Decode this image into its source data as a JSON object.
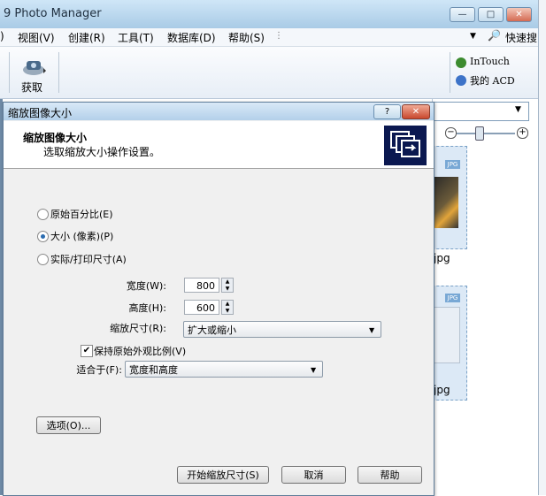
{
  "app": {
    "title": "9 Photo Manager",
    "window_buttons": {
      "minimize": "—",
      "maximize": "□",
      "close": "✕"
    }
  },
  "menu": {
    "items": [
      ") ",
      "视图(V)",
      "创建(R)",
      "工具(T)",
      "数据库(D)",
      "帮助(S)"
    ],
    "quick_search_label": "快速搜"
  },
  "toolbar": {
    "acquire_label": "获取",
    "intouch_label": "InTouch",
    "myacd_label": "我的 ACD"
  },
  "thumbnails": [
    {
      "badge": "JPG",
      "name": "jpg"
    },
    {
      "badge": "JPG",
      "name": "jpg"
    }
  ],
  "dialog": {
    "title": "缩放图像大小",
    "help_btn": "?",
    "close_btn": "✕",
    "header_title": "缩放图像大小",
    "header_subtitle": "选取缩放大小操作设置。",
    "options": [
      {
        "label": "原始百分比(E)",
        "checked": false
      },
      {
        "label": "大小 (像素)(P)",
        "checked": true
      },
      {
        "label": "实际/打印尺寸(A)",
        "checked": false
      }
    ],
    "width_label": "宽度(W):",
    "width_value": "800",
    "height_label": "高度(H):",
    "height_value": "600",
    "resize_label": "缩放尺寸(R):",
    "resize_value": "扩大或缩小",
    "keep_ratio_label": "保持原始外观比例(V)",
    "keep_ratio_checked": true,
    "fit_label": "适合于(F):",
    "fit_value": "宽度和高度",
    "options_btn": "选项(O)...",
    "start_btn": "开始缩放尺寸(S)",
    "cancel_btn": "取消",
    "help_button": "帮助"
  }
}
